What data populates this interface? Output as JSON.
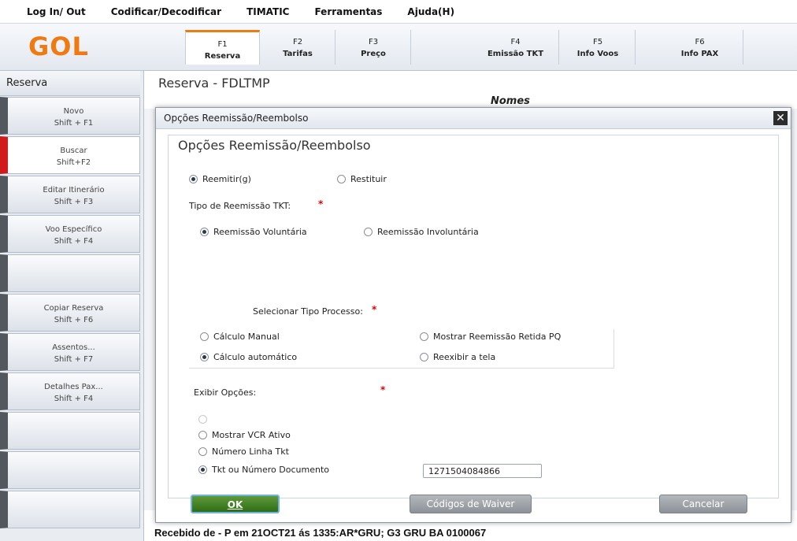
{
  "menu": [
    "Log In/ Out",
    "Codificar/Decodificar",
    "TIMATIC",
    "Ferramentas",
    "Ajuda(H)"
  ],
  "logo": "GOL",
  "fkeys": [
    {
      "key": "F1",
      "label": "Reserva"
    },
    {
      "key": "F2",
      "label": "Tarifas"
    },
    {
      "key": "F3",
      "label": "Preço"
    },
    {
      "key": "F4",
      "label": "Emissão TKT"
    },
    {
      "key": "F5",
      "label": "Info Voos"
    },
    {
      "key": "F6",
      "label": "Info PAX"
    }
  ],
  "sidebar": {
    "title": "Reserva",
    "items": [
      {
        "label": "Novo",
        "shortcut": "Shift + F1"
      },
      {
        "label": "Buscar",
        "shortcut": "Shift+F2"
      },
      {
        "label": "Editar Itinerário",
        "shortcut": "Shift + F3"
      },
      {
        "label": "Voo Específico",
        "shortcut": "Shift + F4"
      },
      {
        "label": "",
        "shortcut": ""
      },
      {
        "label": "Copiar Reserva",
        "shortcut": "Shift + F6"
      },
      {
        "label": "Assentos...",
        "shortcut": "Shift + F7"
      },
      {
        "label": "Detalhes Pax...",
        "shortcut": "Shift + F4"
      },
      {
        "label": "",
        "shortcut": ""
      },
      {
        "label": "",
        "shortcut": ""
      },
      {
        "label": "",
        "shortcut": ""
      }
    ]
  },
  "main": {
    "title": "Reserva - FDLTMP",
    "nomes_header": "Nomes",
    "status": "Recebido de - P em 21OCT21  ás 1335:AR*GRU; G3 GRU BA 0100067"
  },
  "dialog": {
    "title": "Opções Reemissão/Reembolso",
    "heading": "Opções Reemissão/Reembolso",
    "reemitir": "Reemitir(g)",
    "restituir": "Restituir",
    "tipo_label": "Tipo de Reemissão TKT:",
    "voluntaria": "Reemissão Voluntária",
    "involuntaria": "Reemissão Involuntária",
    "processo_label": "Selecionar Tipo Processo:",
    "calc_manual": "Cálculo Manual",
    "calc_auto": "Cálculo automático",
    "mostrar_retida": "Mostrar Reemissão Retida PQ",
    "reexibir": "Reexibir a tela",
    "exibir_label": "Exibir Opções:",
    "mostrar_vcr": "Mostrar VCR Ativo",
    "numero_linha": "Número Linha Tkt",
    "tkt_doc": "Tkt ou Número Documento",
    "doc_value": "1271504084866",
    "ok": "OK",
    "waiver": "Códigos de Waiver",
    "cancel": "Cancelar",
    "required_mark": "*"
  },
  "colors": {
    "brand": "#f07a12",
    "ok_green": "#3f7f1f",
    "required": "#dd0000"
  }
}
